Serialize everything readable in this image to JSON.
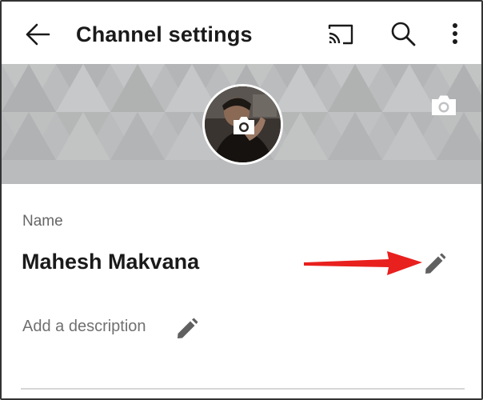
{
  "appbar": {
    "title": "Channel settings",
    "icons": {
      "back": "arrow-left-icon",
      "cast": "cast-icon",
      "search": "search-icon",
      "more": "more-vertical-icon"
    }
  },
  "banner": {
    "avatar_camera_icon": "camera-icon",
    "banner_camera_icon": "camera-icon"
  },
  "fields": {
    "name_label": "Name",
    "name_value": "Mahesh Makvana",
    "name_edit_icon": "pencil-icon",
    "description_placeholder": "Add a description",
    "description_edit_icon": "pencil-icon"
  },
  "annotation": {
    "arrow_color": "#e8201e"
  },
  "colors": {
    "text_primary": "#1a1a1a",
    "text_secondary": "#666666",
    "banner_bg": "#bfc1c2",
    "icon": "#606060"
  }
}
